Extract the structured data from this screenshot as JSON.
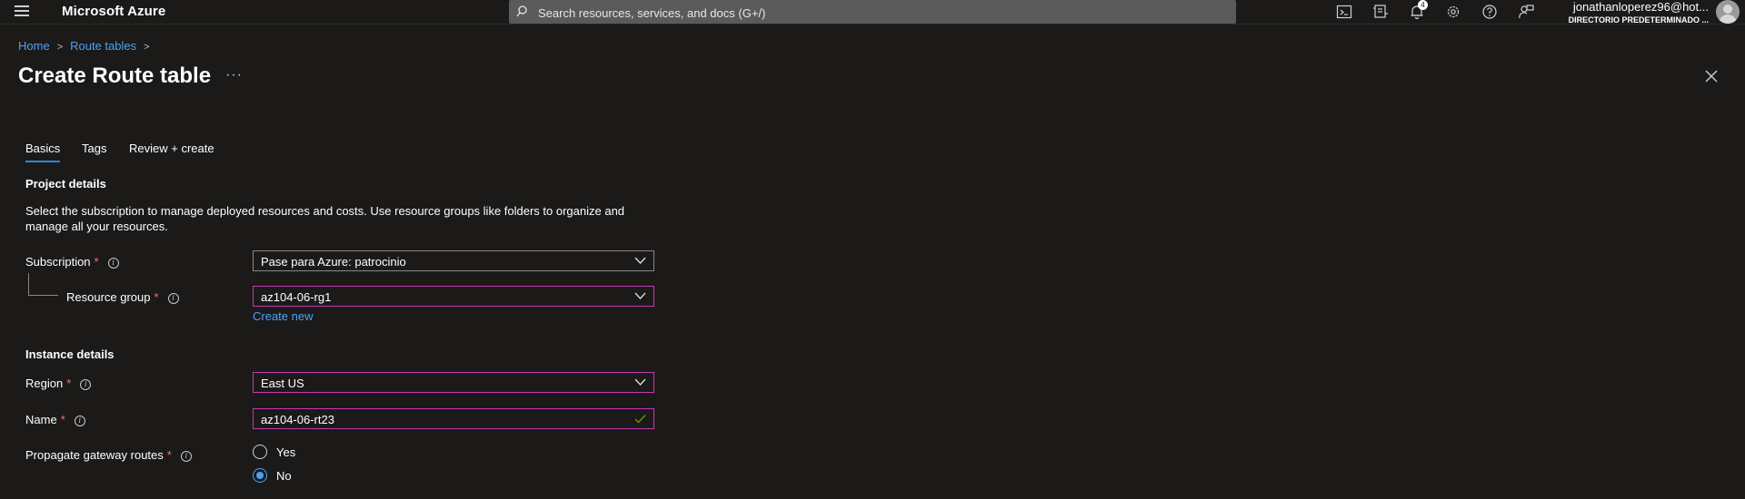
{
  "topbar": {
    "brand": "Microsoft Azure",
    "search_placeholder": "Search resources, services, and docs (G+/)",
    "notification_count": "4",
    "account_name": "jonathanloperez96@hot...",
    "account_directory": "DIRECTORIO PREDETERMINADO ..."
  },
  "breadcrumb": {
    "home": "Home",
    "route_tables": "Route tables"
  },
  "page": {
    "title": "Create Route table",
    "more": "···"
  },
  "tabs": [
    "Basics",
    "Tags",
    "Review + create"
  ],
  "project": {
    "heading": "Project details",
    "description": "Select the subscription to manage deployed resources and costs. Use resource groups like folders to organize and manage all your resources.",
    "subscription_label": "Subscription",
    "subscription_value": "Pase para Azure: patrocinio",
    "resource_group_label": "Resource group",
    "resource_group_value": "az104-06-rg1",
    "create_new": "Create new"
  },
  "instance": {
    "heading": "Instance details",
    "region_label": "Region",
    "region_value": "East US",
    "name_label": "Name",
    "name_value": "az104-06-rt23",
    "propagate_label": "Propagate gateway routes",
    "option_yes": "Yes",
    "option_no": "No",
    "selected": "No"
  },
  "required_mark": "*",
  "colors": {
    "accent": "#4ea1f5",
    "focus_border": "#c239b3",
    "required": "#f1707b",
    "background": "#1b1a19"
  }
}
